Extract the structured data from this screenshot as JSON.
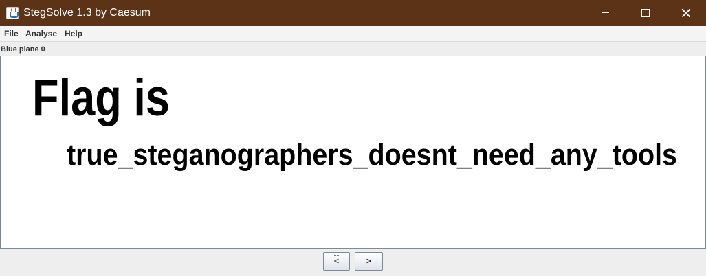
{
  "window": {
    "title": "StegSolve 1.3 by Caesum"
  },
  "menu": {
    "items": [
      "File",
      "Analyse",
      "Help"
    ]
  },
  "viewer": {
    "plane_label": "Blue plane 0",
    "image_text_line1": "Flag is",
    "image_text_line2": "true_steganographers_doesnt_need_any_tools"
  },
  "nav": {
    "prev_label": "<",
    "next_label": ">"
  },
  "colors": {
    "titlebar": "#5c3317",
    "window_bg": "#eeeeee",
    "image_bg": "#ffffff",
    "image_text": "#000000"
  },
  "icons": [
    "java-app-icon",
    "minimize-icon",
    "maximize-icon",
    "close-icon"
  ]
}
